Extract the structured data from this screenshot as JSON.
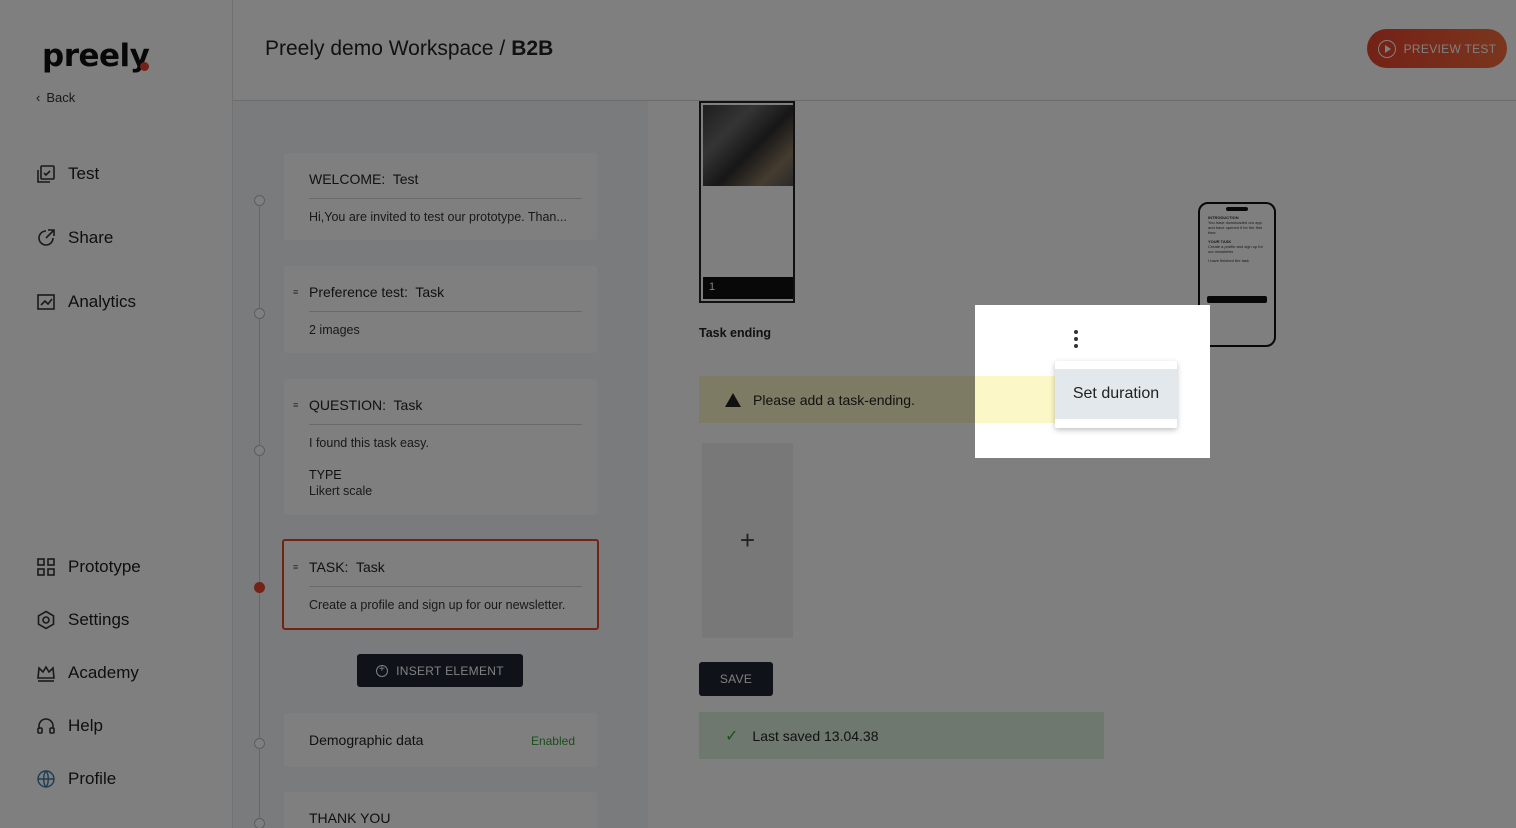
{
  "sidebar": {
    "logo": "preely",
    "back": "Back",
    "nav_top": [
      {
        "label": "Test",
        "icon": "test-icon"
      },
      {
        "label": "Share",
        "icon": "share-icon"
      },
      {
        "label": "Analytics",
        "icon": "analytics-icon"
      }
    ],
    "nav_bottom": [
      {
        "label": "Prototype",
        "icon": "grid-icon"
      },
      {
        "label": "Settings",
        "icon": "gear-icon"
      },
      {
        "label": "Academy",
        "icon": "crown-icon"
      },
      {
        "label": "Help",
        "icon": "headset-icon"
      },
      {
        "label": "Profile",
        "icon": "globe-icon"
      }
    ]
  },
  "header": {
    "workspace": "Preely demo Workspace",
    "separator": "/",
    "project": "B2B",
    "preview_button": "PREVIEW TEST"
  },
  "flow": {
    "cards": [
      {
        "type_label": "WELCOME:",
        "name": "Test",
        "body": "Hi,You are invited to test our prototype. Than..."
      },
      {
        "type_label": "Preference test:",
        "name": "Task",
        "body": "2 images"
      },
      {
        "type_label": "QUESTION:",
        "name": "Task",
        "body": "I found this task easy.",
        "type_heading": "TYPE",
        "type_value": "Likert scale"
      },
      {
        "type_label": "TASK:",
        "name": "Task",
        "body": "Create a profile and sign up for our newsletter."
      }
    ],
    "insert_button": "INSERT ELEMENT",
    "demographic": {
      "label": "Demographic data",
      "status": "Enabled"
    },
    "thank_you": "THANK YOU"
  },
  "main": {
    "thumbnail_number": "1",
    "task_ending_label": "Task ending",
    "warning_text": "Please add a task-ending.",
    "add_symbol": "+",
    "save_button": "SAVE",
    "saved_text": "Last saved 13.04.38"
  },
  "phone_preview": {
    "intro_heading": "INTRODUCTION",
    "intro_text": "You have downloaded our app and have opened it for the first time.",
    "task_heading": "YOUR TASK",
    "task_text": "Create a profile and sign up for our newsletter",
    "checkbox_label": "I have finished the task",
    "start_button": "START"
  },
  "context_menu": {
    "items": [
      "Set duration"
    ]
  },
  "colors": {
    "accent": "#e8432d",
    "dark_button": "#1f2732",
    "warning_bg": "#fbf7c7",
    "success_bg": "#dff0df",
    "enabled_text": "#33a03a"
  }
}
